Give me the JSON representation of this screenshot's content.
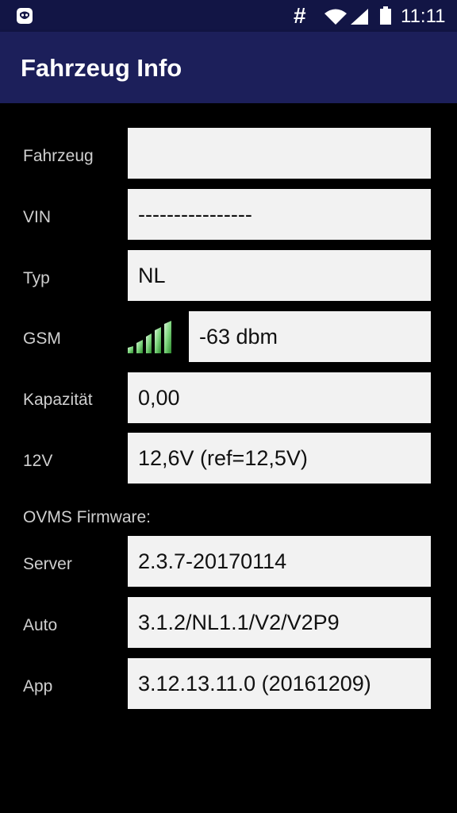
{
  "status_bar": {
    "time": "11:11",
    "hash_symbol": "#",
    "icons": [
      "app-notification-icon",
      "wifi-icon",
      "cell-signal-icon",
      "battery-icon"
    ]
  },
  "app_bar": {
    "title": "Fahrzeug Info"
  },
  "rows": {
    "fahrzeug": {
      "label": "Fahrzeug",
      "value": ""
    },
    "vin": {
      "label": "VIN",
      "value": "----------------"
    },
    "typ": {
      "label": "Typ",
      "value": "NL"
    },
    "gsm": {
      "label": "GSM",
      "value": "-63 dbm",
      "signal_bars": 5,
      "signal_icon": "signal-strength-icon"
    },
    "kapazitaet": {
      "label": "Kapazität",
      "value": "0,00"
    },
    "v12": {
      "label": "12V",
      "value": "12,6V (ref=12,5V)"
    }
  },
  "firmware": {
    "heading": "OVMS Firmware:",
    "server": {
      "label": "Server",
      "value": "2.3.7-20170114"
    },
    "auto": {
      "label": "Auto",
      "value": "3.1.2/NL1.1/V2/V2P9"
    },
    "app": {
      "label": "App",
      "value": "3.12.13.11.0 (20161209)"
    }
  },
  "colors": {
    "status_bar_bg": "#121545",
    "app_bar_bg": "#1c1f5a",
    "background": "#000000",
    "field_bg": "#f2f2f2",
    "label_text": "#cfcfcf",
    "signal_green": "#7fd67f"
  }
}
